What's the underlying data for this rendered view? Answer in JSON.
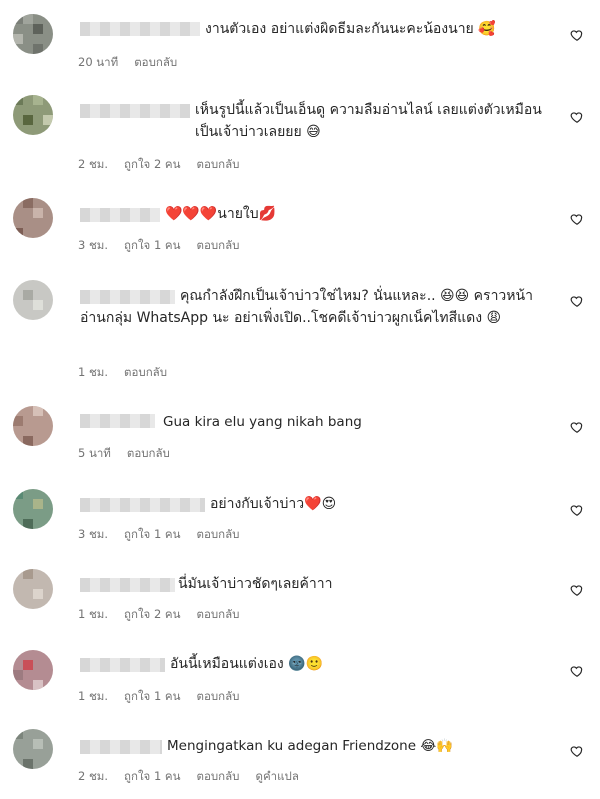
{
  "comments": [
    {
      "text": "งานตัวเอง อย่าแต่งผิดธีมละกันนะคะน้องนาย 🥰",
      "time": "20 นาที",
      "likes": "",
      "reply": "ตอบกลับ",
      "translate": ""
    },
    {
      "text": "เห็นรูปนี้แล้วเป็นเอ็นดู ความลืมอ่านไลน์ เลยแต่งตัวเหมือนเป็นเจ้าบ่าวเลยยย 😅",
      "time": "2 ชม.",
      "likes": "ถูกใจ 2 คน",
      "reply": "ตอบกลับ",
      "translate": ""
    },
    {
      "text": "❤️❤️❤️นายใบ💋",
      "time": "3 ชม.",
      "likes": "ถูกใจ 1 คน",
      "reply": "ตอบกลับ",
      "translate": ""
    },
    {
      "text": "คุณกำลังฝึกเป็นเจ้าบ่าวใช่ไหม? นั่นแหละ.. 😆😆 คราวหน้าอ่านกลุ่ม WhatsApp นะ อย่าเพิ่งเปิด..โชคดีเจ้าบ่าวผูกเน็คไทสีแดง 😩",
      "time": "1 ชม.",
      "likes": "",
      "reply": "ตอบกลับ",
      "translate": ""
    },
    {
      "text": "Gua kira elu yang nikah bang",
      "time": "5 นาที",
      "likes": "",
      "reply": "ตอบกลับ",
      "translate": ""
    },
    {
      "text": "อย่างกับเจ้าบ่าว❤️😍",
      "time": "3 ชม.",
      "likes": "ถูกใจ 1 คน",
      "reply": "ตอบกลับ",
      "translate": ""
    },
    {
      "text": "นี่มันเจ้าบ่าวชัดๆเลยค้าาา",
      "time": "1 ชม.",
      "likes": "ถูกใจ 2 คน",
      "reply": "ตอบกลับ",
      "translate": ""
    },
    {
      "text": "อันนี้เหมือนแต่งเอง 🌚🙂",
      "time": "1 ชม.",
      "likes": "ถูกใจ 1 คน",
      "reply": "ตอบกลับ",
      "translate": ""
    },
    {
      "text": "Mengingatkan ku adegan Friendzone 😂🙌",
      "time": "2 ชม.",
      "likes": "ถูกใจ 1 คน",
      "reply": "ตอบกลับ",
      "translate": "ดูคำแปล"
    }
  ],
  "icons": {
    "like": "heart-outline-icon"
  }
}
